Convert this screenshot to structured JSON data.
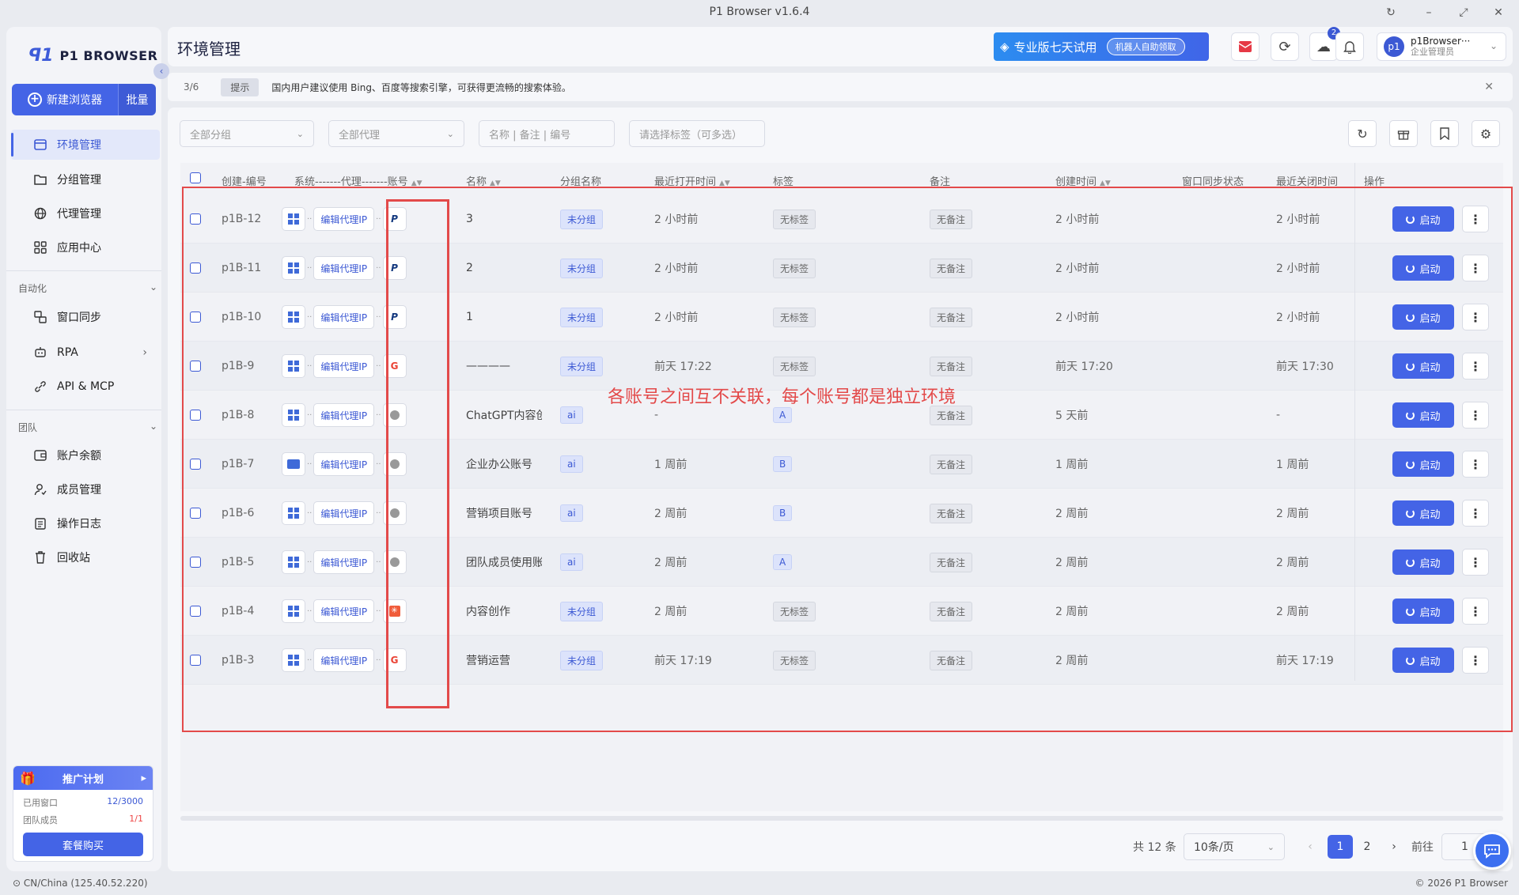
{
  "window": {
    "title": "P1 Browser v1.6.4",
    "controls": {
      "refresh": "↻",
      "minimize": "–",
      "maximize": "⤢",
      "close": "✕"
    }
  },
  "sidebar": {
    "logo_mark": "ꟼ1",
    "logo_text": "P1 BROWSER",
    "new_browser_label": "新建浏览器",
    "batch_label": "批量",
    "items": [
      {
        "label": "环境管理",
        "icon": "browser-window-icon"
      },
      {
        "label": "分组管理",
        "icon": "folder-icon"
      },
      {
        "label": "代理管理",
        "icon": "globe-icon"
      },
      {
        "label": "应用中心",
        "icon": "grid-apps-icon"
      }
    ],
    "section_automation": "自动化",
    "automation_items": [
      {
        "label": "窗口同步",
        "icon": "window-sync-icon"
      },
      {
        "label": "RPA",
        "icon": "robot-icon"
      },
      {
        "label": "API & MCP",
        "icon": "api-link-icon"
      }
    ],
    "section_team": "团队",
    "team_items": [
      {
        "label": "账户余额",
        "icon": "wallet-icon"
      },
      {
        "label": "成员管理",
        "icon": "member-icon"
      },
      {
        "label": "操作日志",
        "icon": "log-icon"
      },
      {
        "label": "回收站",
        "icon": "trash-icon"
      }
    ],
    "promo": {
      "title": "推广计划",
      "used_windows_label": "已用窗口",
      "used_windows_value": "12/3000",
      "team_members_label": "团队成员",
      "team_members_value": "1/1",
      "buy_label": "套餐购买"
    },
    "location": "CN/China (125.40.52.220)"
  },
  "footer": {
    "copyright": "© 2026 P1 Browser"
  },
  "header": {
    "page_title": "环境管理",
    "trial_text": "专业版七天试用",
    "trial_pill": "机器人自助领取",
    "download_badge": "2",
    "user_name": "p1Browser···",
    "user_role": "企业管理员",
    "avatar_text": "p1"
  },
  "tip": {
    "count": "3/6",
    "tag": "提示",
    "message": "国内用户建议使用 Bing、百度等搜索引擎，可获得更流畅的搜索体验。"
  },
  "filters": {
    "group_placeholder": "全部分组",
    "proxy_placeholder": "全部代理",
    "search_placeholder": "名称 | 备注 | 编号",
    "tags_placeholder": "请选择标签（可多选）"
  },
  "table": {
    "headers": {
      "id": "创建-编号",
      "system": "系统-------代理-------账号",
      "name": "名称",
      "group": "分组名称",
      "last_open": "最近打开时间",
      "tags": "标签",
      "remark": "备注",
      "created": "创建时间",
      "sync": "窗口同步状态",
      "last_close": "最近关闭时间",
      "ops": "操作"
    },
    "proxy_btn": "编辑代理IP",
    "start_btn": "启动",
    "rows": [
      {
        "id": "p1B-12",
        "os": "windows",
        "account": "paypal",
        "name": "3",
        "group": "未分组",
        "last_open": "2 小时前",
        "tag": "无标签",
        "remark": "无备注",
        "created": "2 小时前",
        "last_close": "2 小时前"
      },
      {
        "id": "p1B-11",
        "os": "windows",
        "account": "paypal",
        "name": "2",
        "group": "未分组",
        "last_open": "2 小时前",
        "tag": "无标签",
        "remark": "无备注",
        "created": "2 小时前",
        "last_close": "2 小时前"
      },
      {
        "id": "p1B-10",
        "os": "windows",
        "account": "paypal",
        "name": "1",
        "group": "未分组",
        "last_open": "2 小时前",
        "tag": "无标签",
        "remark": "无备注",
        "created": "2 小时前",
        "last_close": "2 小时前"
      },
      {
        "id": "p1B-9",
        "os": "windows",
        "account": "google",
        "name": "————",
        "group": "未分组",
        "last_open": "前天 17:22",
        "tag": "无标签",
        "remark": "无备注",
        "created": "前天 17:20",
        "last_close": "前天 17:30"
      },
      {
        "id": "p1B-8",
        "os": "windows",
        "account": "openai",
        "name": "ChatGPT内容创",
        "group": "ai",
        "last_open": "-",
        "tag": "A",
        "remark": "无备注",
        "created": "5 天前",
        "last_close": "-"
      },
      {
        "id": "p1B-7",
        "os": "mac",
        "account": "openai",
        "name": "企业办公账号",
        "group": "ai",
        "last_open": "1 周前",
        "tag": "B",
        "remark": "无备注",
        "created": "1 周前",
        "last_close": "1 周前"
      },
      {
        "id": "p1B-6",
        "os": "windows",
        "account": "openai",
        "name": "营销项目账号",
        "group": "ai",
        "last_open": "2 周前",
        "tag": "B",
        "remark": "无备注",
        "created": "2 周前",
        "last_close": "2 周前"
      },
      {
        "id": "p1B-5",
        "os": "windows",
        "account": "openai",
        "name": "团队成员使用账",
        "group": "ai",
        "last_open": "2 周前",
        "tag": "A",
        "remark": "无备注",
        "created": "2 周前",
        "last_close": "2 周前"
      },
      {
        "id": "p1B-4",
        "os": "windows",
        "account": "claude",
        "name": "内容创作",
        "group": "未分组",
        "last_open": "2 周前",
        "tag": "无标签",
        "remark": "无备注",
        "created": "2 周前",
        "last_close": "2 周前"
      },
      {
        "id": "p1B-3",
        "os": "windows",
        "account": "google",
        "name": "营销运营",
        "group": "未分组",
        "last_open": "前天 17:19",
        "tag": "无标签",
        "remark": "无备注",
        "created": "2 周前",
        "last_close": "前天 17:19"
      }
    ]
  },
  "annotation": {
    "text": "各账号之间互不关联，每个账号都是独立环境",
    "color": "#e34a4a"
  },
  "pagination": {
    "total": "共 12 条",
    "page_size": "10条/页",
    "pages": [
      "1",
      "2"
    ],
    "current": "1",
    "goto_label": "前往",
    "goto_value": "1"
  },
  "colors": {
    "accent": "#4464e6",
    "annotation": "#e34a4a"
  }
}
